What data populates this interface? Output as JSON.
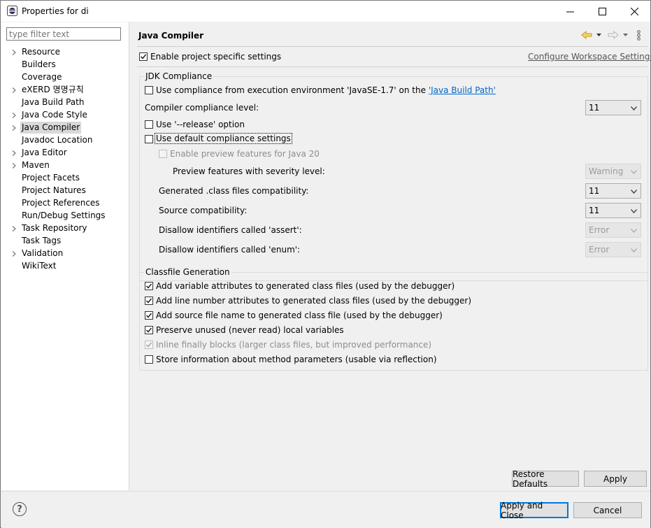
{
  "window": {
    "title": "Properties for di",
    "minimize_glyph": "—",
    "maximize_glyph": "☐",
    "close_glyph": "✕"
  },
  "sidebar": {
    "filter_placeholder": "type filter text",
    "items": [
      {
        "label": "Resource",
        "expandable": true
      },
      {
        "label": "Builders",
        "expandable": false
      },
      {
        "label": "Coverage",
        "expandable": false
      },
      {
        "label": "eXERD 명명규칙",
        "expandable": true
      },
      {
        "label": "Java Build Path",
        "expandable": false
      },
      {
        "label": "Java Code Style",
        "expandable": true
      },
      {
        "label": "Java Compiler",
        "expandable": true,
        "selected": true
      },
      {
        "label": "Javadoc Location",
        "expandable": false
      },
      {
        "label": "Java Editor",
        "expandable": true
      },
      {
        "label": "Maven",
        "expandable": true
      },
      {
        "label": "Project Facets",
        "expandable": false
      },
      {
        "label": "Project Natures",
        "expandable": false
      },
      {
        "label": "Project References",
        "expandable": false
      },
      {
        "label": "Run/Debug Settings",
        "expandable": false
      },
      {
        "label": "Task Repository",
        "expandable": true
      },
      {
        "label": "Task Tags",
        "expandable": false
      },
      {
        "label": "Validation",
        "expandable": true
      },
      {
        "label": "WikiText",
        "expandable": false
      }
    ]
  },
  "main": {
    "title": "Java Compiler",
    "enable_project_specific": {
      "label": "Enable project specific settings",
      "checked": true
    },
    "configure_workspace_link": "Configure Workspace Settings...",
    "jdk": {
      "group_title": "JDK Compliance",
      "use_compliance_env": {
        "label": "Use compliance from execution environment 'JavaSE-1.7' on the ",
        "link": "'Java Build Path'",
        "checked": false
      },
      "compiler_level_label": "Compiler compliance level:",
      "compiler_level_value": "11",
      "use_release": {
        "label": "Use '--release' option",
        "checked": false
      },
      "use_default": {
        "label": "Use default compliance settings",
        "checked": false
      },
      "enable_preview": {
        "label": "Enable preview features for Java 20",
        "checked": false
      },
      "preview_severity_label": "Preview features with severity level:",
      "preview_severity_value": "Warning",
      "generated_compat_label": "Generated .class files compatibility:",
      "generated_compat_value": "11",
      "source_compat_label": "Source compatibility:",
      "source_compat_value": "11",
      "assert_label": "Disallow identifiers called 'assert':",
      "assert_value": "Error",
      "enum_label": "Disallow identifiers called 'enum':",
      "enum_value": "Error"
    },
    "classfile": {
      "group_title": "Classfile Generation",
      "options": [
        {
          "label": "Add variable attributes to generated class files (used by the debugger)",
          "checked": true,
          "disabled": false
        },
        {
          "label": "Add line number attributes to generated class files (used by the debugger)",
          "checked": true,
          "disabled": false
        },
        {
          "label": "Add source file name to generated class file (used by the debugger)",
          "checked": true,
          "disabled": false
        },
        {
          "label": "Preserve unused (never read) local variables",
          "checked": true,
          "disabled": false
        },
        {
          "label": "Inline finally blocks (larger class files, but improved performance)",
          "checked": true,
          "disabled": true
        },
        {
          "label": "Store information about method parameters (usable via reflection)",
          "checked": false,
          "disabled": false
        }
      ]
    },
    "restore_defaults_label": "Restore Defaults",
    "apply_label": "Apply"
  },
  "footer": {
    "help_glyph": "?",
    "apply_close_label": "Apply and Close",
    "cancel_label": "Cancel"
  }
}
